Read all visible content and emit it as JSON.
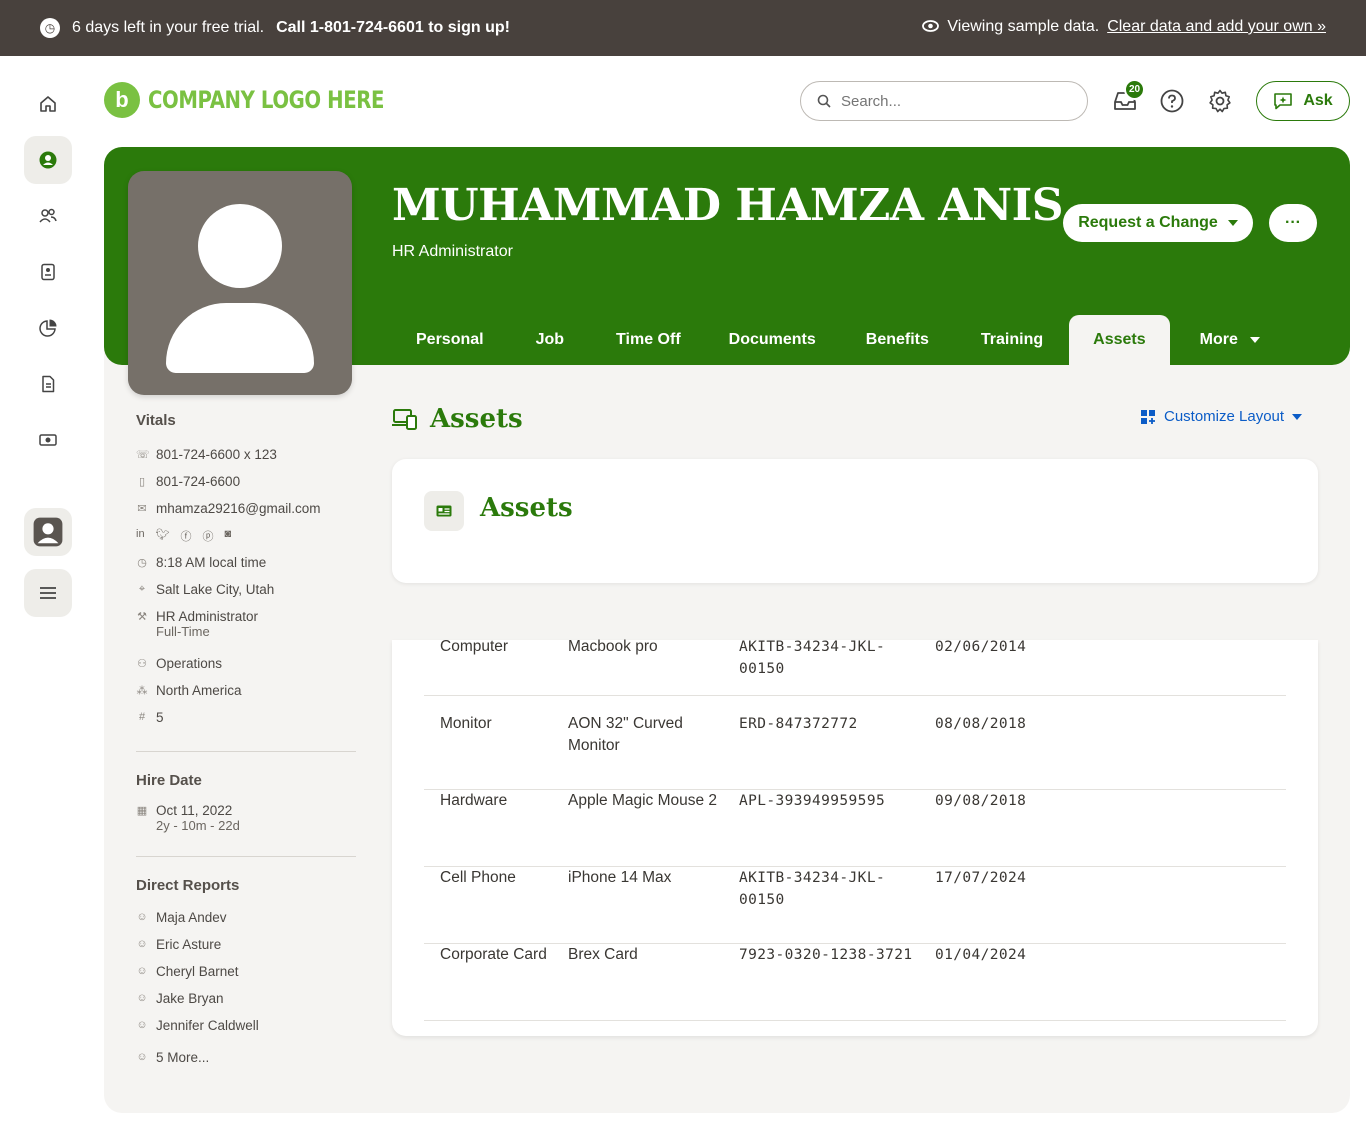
{
  "banner": {
    "trial_text": "6 days left in your free trial.",
    "call_text": "Call 1-801-724-6601 to sign up!",
    "viewing_text": "Viewing sample data.",
    "clear_link": "Clear data and add your own »"
  },
  "header": {
    "logo_text": "COMPANY LOGO HERE",
    "logo_mark": "b",
    "search_placeholder": "Search...",
    "notification_count": "20",
    "ask_label": "Ask"
  },
  "profile": {
    "name": "MUHAMMAD HAMZA ANIS",
    "title": "HR Administrator",
    "request_change_label": "Request a Change",
    "more_dots": "···"
  },
  "tabs": [
    {
      "label": "Personal"
    },
    {
      "label": "Job"
    },
    {
      "label": "Time Off"
    },
    {
      "label": "Documents"
    },
    {
      "label": "Benefits"
    },
    {
      "label": "Training"
    },
    {
      "label": "Assets"
    },
    {
      "label": "More"
    }
  ],
  "vitals": {
    "heading": "Vitals",
    "work_phone": "801-724-6600 x 123",
    "mobile_phone": "801-724-6600",
    "email": "mhamza29216@gmail.com",
    "local_time": "8:18 AM local time",
    "location": "Salt Lake City, Utah",
    "job_title": "HR Administrator",
    "employment_type": "Full-Time",
    "department": "Operations",
    "division": "North America",
    "employee_number": "5"
  },
  "hire": {
    "heading": "Hire Date",
    "date": "Oct 11, 2022",
    "tenure": "2y - 10m - 22d"
  },
  "reports": {
    "heading": "Direct Reports",
    "people": [
      "Maja Andev",
      "Eric Asture",
      "Cheryl Barnet",
      "Jake Bryan",
      "Jennifer Caldwell"
    ],
    "more": "5 More..."
  },
  "assets_section": {
    "title": "Assets",
    "customize_label": "Customize Layout",
    "card_title": "Assets"
  },
  "assets": [
    {
      "category": "Computer",
      "description": "Macbook pro",
      "serial": "AKITB-34234-JKL-00150",
      "date": "02/06/2014"
    },
    {
      "category": "Monitor",
      "description": "AON 32\" Curved Monitor",
      "serial": "ERD-847372772",
      "date": "08/08/2018"
    },
    {
      "category": "Hardware",
      "description": "Apple Magic Mouse 2",
      "serial": "APL-393949959595",
      "date": "09/08/2018"
    },
    {
      "category": "Cell Phone",
      "description": "iPhone 14 Max",
      "serial": "AKITB-34234-JKL-00150",
      "date": "17/07/2024"
    },
    {
      "category": "Corporate Card",
      "description": "Brex Card",
      "serial": "7923-0320-1238-3721",
      "date": "01/04/2024"
    }
  ],
  "colors": {
    "brand_green": "#2b7a0b",
    "logo_green": "#7ac142",
    "banner_bg": "#48413d",
    "link_blue": "#0b5cc7"
  }
}
